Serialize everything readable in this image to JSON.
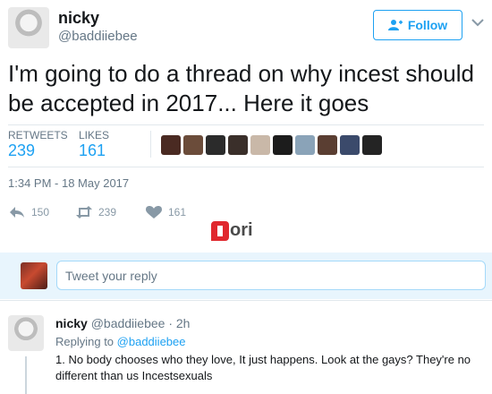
{
  "author": {
    "name": "nicky",
    "handle": "@baddiiebee",
    "follow_label": "Follow"
  },
  "tweet": {
    "text": "I'm going to do a thread on why incest should be accepted in 2017... Here it goes",
    "retweets_label": "RETWEETS",
    "retweets_count": "239",
    "likes_label": "LIKES",
    "likes_count": "161",
    "timestamp": "1:34 PM - 18 May 2017"
  },
  "actions": {
    "reply_count": "150",
    "retweet_count": "239",
    "like_count": "161"
  },
  "liker_avatar_colors": [
    "#4a2a22",
    "#6b4c3a",
    "#2b2b2b",
    "#3a2f2a",
    "#c9b8a8",
    "#1c1c1c",
    "#8aa3b8",
    "#5a3e32",
    "#3b4a6b",
    "#242424"
  ],
  "watermark": {
    "text": "ori"
  },
  "reply_box": {
    "placeholder": "Tweet your reply"
  },
  "reply": {
    "name": "nicky",
    "handle_time": "@baddiiebee · 2h",
    "replying_prefix": "Replying to",
    "replying_to": "@baddiiebee",
    "text": "1. No body chooses who they love, It just happens. Look at the gays? They're no different than us Incestsexuals"
  },
  "colors": {
    "accent": "#1da1f2",
    "muted": "#657786",
    "like": "#e0245e"
  }
}
